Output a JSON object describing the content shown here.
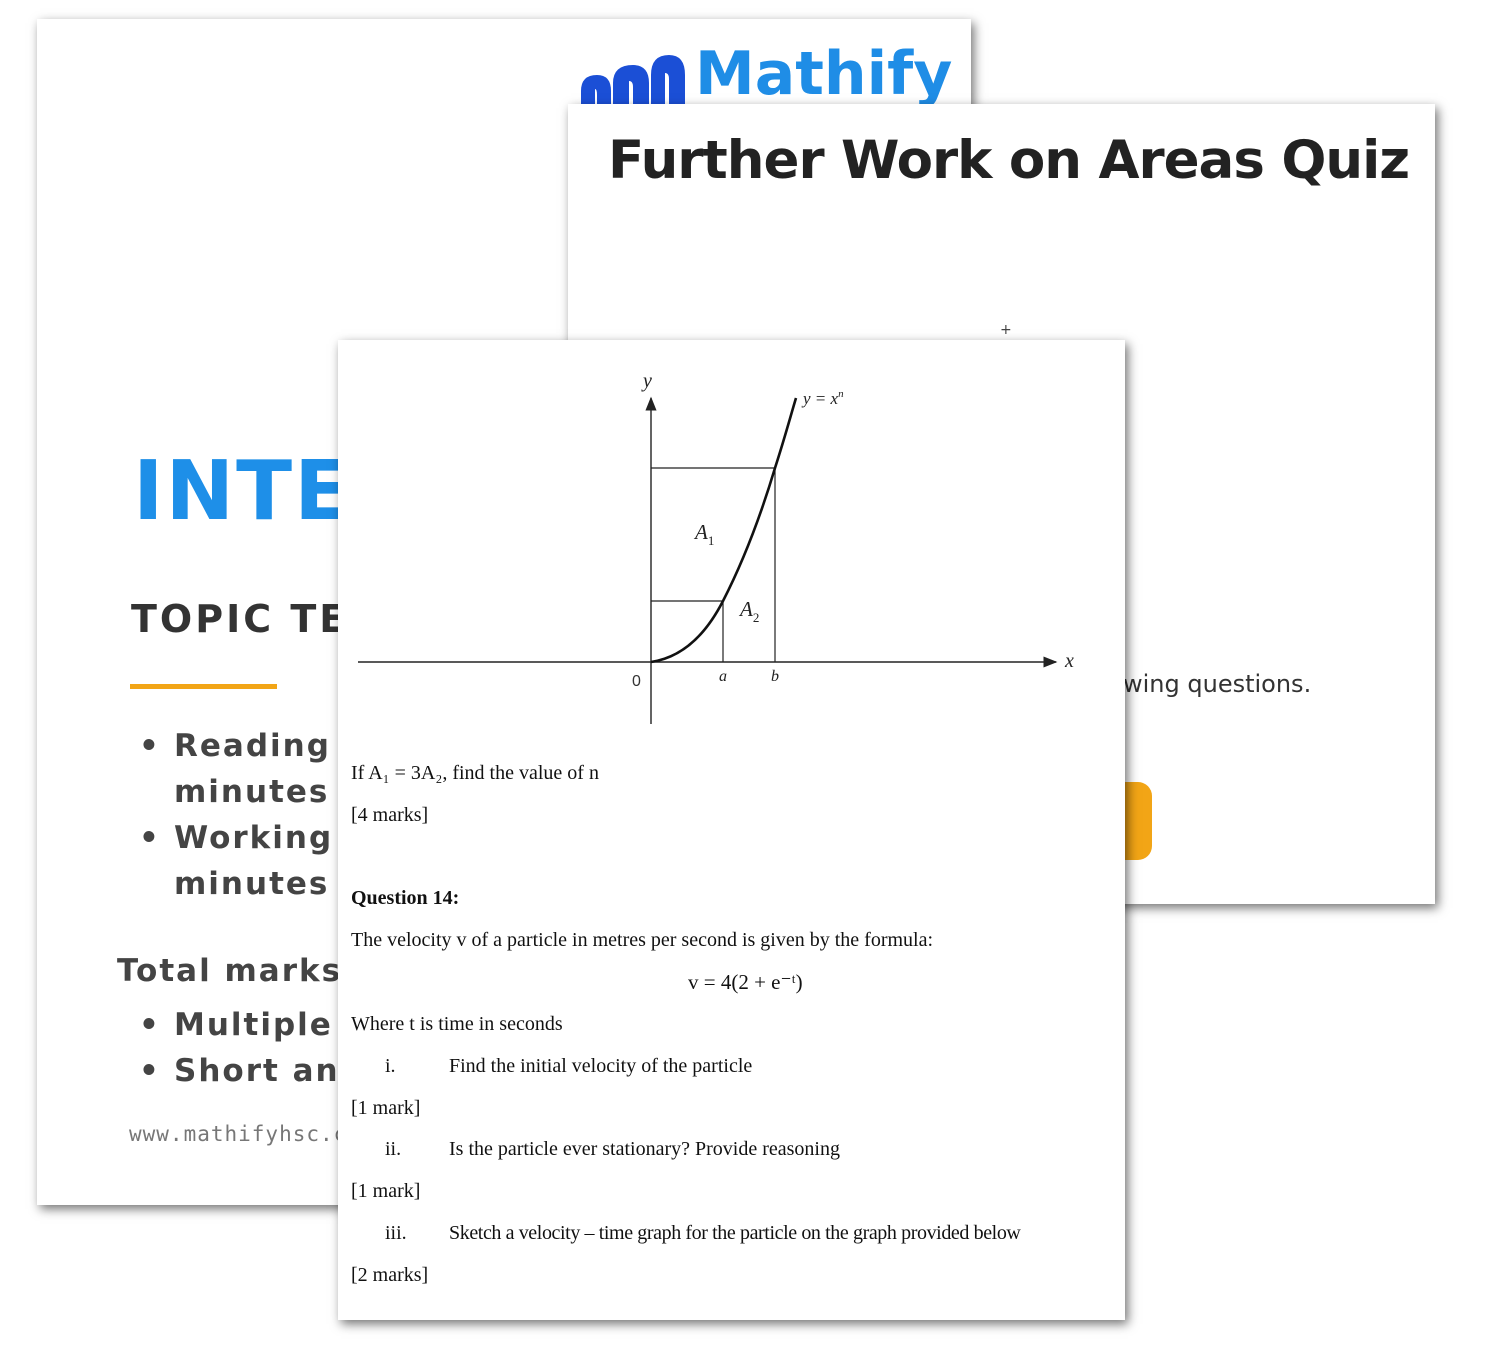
{
  "back_sheet": {
    "logo_text": "Mathify",
    "title": "INTE",
    "subtitle": "TOPIC TE",
    "list_1": [
      "Reading t",
      "minutes",
      "Working",
      "minutes"
    ],
    "total_label": "Total marks",
    "list_2": [
      "Multiple",
      "Short ans"
    ],
    "url": "www.mathifyhsc.com."
  },
  "mid_sheet": {
    "title": "Further Work on Areas Quiz",
    "partial_text": "wing questions.",
    "accent_color": "#f2a516"
  },
  "front_sheet": {
    "graph": {
      "curve_label": "y = x",
      "curve_label_exp": "n",
      "y_axis_label": "y",
      "x_axis_label": "x",
      "origin_label": "0",
      "a_label": "a",
      "b_label": "b",
      "region_1_label": "A",
      "region_1_sub": "1",
      "region_2_label": "A",
      "region_2_sub": "2"
    },
    "q13_text": "If A₁ = 3A₂, find the value of n",
    "q13_marks": "[4 marks]",
    "q14_heading": "Question 14:",
    "q14_text": "The velocity v of a particle in metres per second is given by the formula:",
    "q14_formula": "v = 4(2 + e⁻ᵗ)",
    "q14_where": "Where t is time in seconds",
    "items": [
      {
        "num": "i.",
        "text": "Find the initial velocity of the particle",
        "marks": "[1 mark]"
      },
      {
        "num": "ii.",
        "text": "Is the particle ever stationary? Provide reasoning",
        "marks": "[1 mark]"
      },
      {
        "num": "iii.",
        "text": "Sketch a velocity – time graph for the particle on the graph provided below",
        "marks": "[2 marks]"
      }
    ]
  }
}
